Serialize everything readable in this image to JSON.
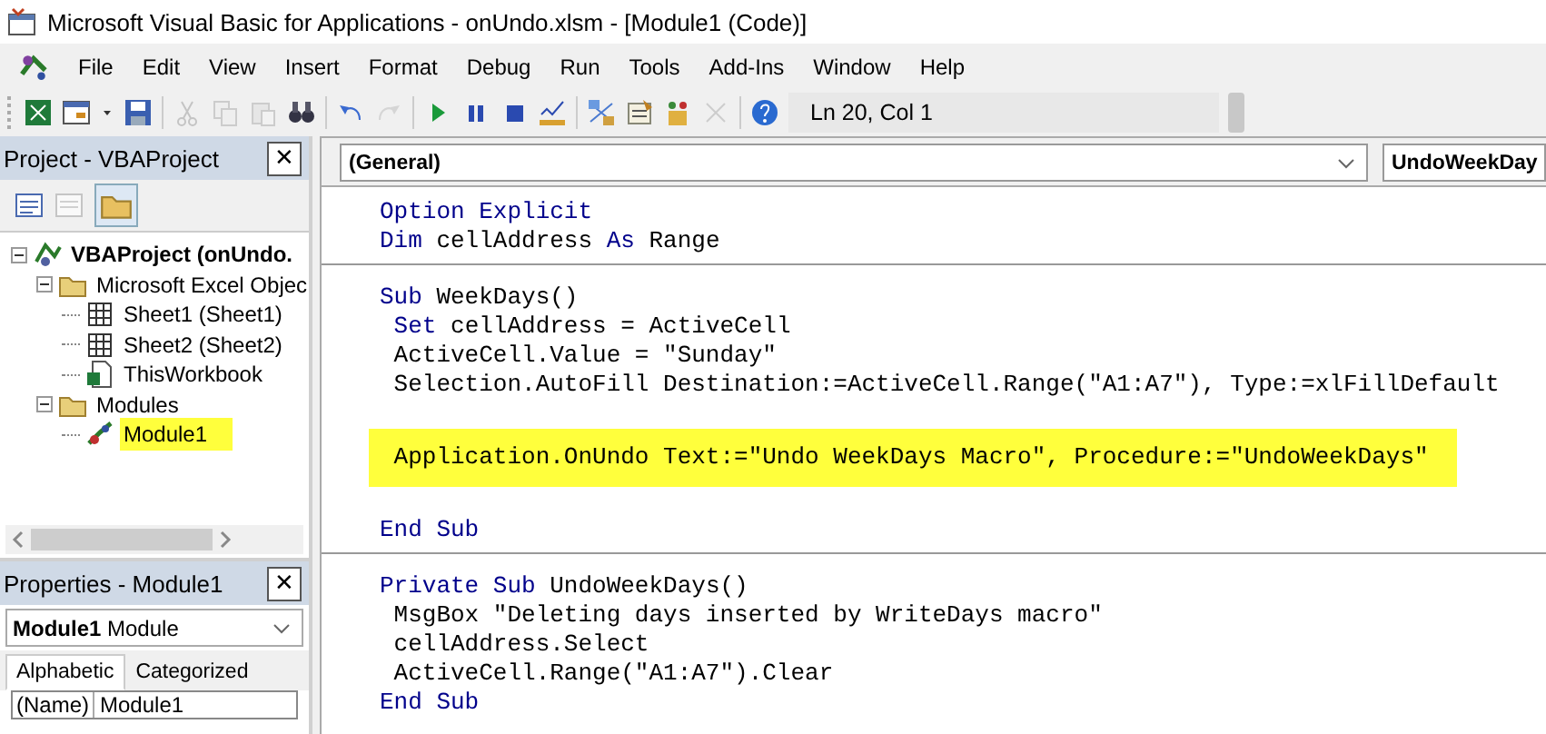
{
  "window": {
    "title": "Microsoft Visual Basic for Applications - onUndo.xlsm - [Module1 (Code)]"
  },
  "menu": [
    "File",
    "Edit",
    "View",
    "Insert",
    "Format",
    "Debug",
    "Run",
    "Tools",
    "Add-Ins",
    "Window",
    "Help"
  ],
  "toolbar": {
    "icons": [
      {
        "kind": "excel"
      },
      {
        "kind": "userform"
      },
      {
        "kind": "dropdown"
      },
      {
        "kind": "save"
      },
      {
        "kind": "sep"
      },
      {
        "kind": "cut",
        "disabled": true
      },
      {
        "kind": "copy",
        "disabled": true
      },
      {
        "kind": "paste",
        "disabled": true
      },
      {
        "kind": "find"
      },
      {
        "kind": "sep"
      },
      {
        "kind": "undo"
      },
      {
        "kind": "redo",
        "disabled": true
      },
      {
        "kind": "sep"
      },
      {
        "kind": "run"
      },
      {
        "kind": "pause"
      },
      {
        "kind": "stop"
      },
      {
        "kind": "design"
      },
      {
        "kind": "sep"
      },
      {
        "kind": "explorer"
      },
      {
        "kind": "properties"
      },
      {
        "kind": "browser"
      },
      {
        "kind": "tools",
        "disabled": true
      },
      {
        "kind": "sep"
      },
      {
        "kind": "help"
      }
    ],
    "position": "Ln 20, Col 1"
  },
  "project_panel": {
    "title": "Project - VBAProject",
    "close": "✕",
    "tree": [
      {
        "label": "VBAProject (onUndo.",
        "kind": "project",
        "bold": true,
        "expanded": true,
        "selected": false,
        "children": [
          {
            "label": "Microsoft Excel Objec",
            "kind": "folder",
            "expanded": true,
            "selected": false,
            "children": [
              {
                "label": "Sheet1 (Sheet1)",
                "kind": "sheet",
                "selected": false
              },
              {
                "label": "Sheet2 (Sheet2)",
                "kind": "sheet",
                "selected": false
              },
              {
                "label": "ThisWorkbook",
                "kind": "workbook",
                "selected": false
              }
            ]
          },
          {
            "label": "Modules",
            "kind": "folder",
            "expanded": true,
            "selected": false,
            "children": [
              {
                "label": "Module1",
                "kind": "module",
                "selected": true
              }
            ]
          }
        ]
      }
    ]
  },
  "properties_panel": {
    "title": "Properties - Module1",
    "close": "✕",
    "object_name": "Module1",
    "object_type": "Module",
    "tabs": [
      {
        "label": "Alphabetic",
        "selected": true
      },
      {
        "label": "Categorized",
        "selected": false
      }
    ],
    "rows": [
      {
        "name": "(Name)",
        "value": "Module1"
      }
    ]
  },
  "code_window": {
    "object_combo": "(General)",
    "procedure_combo": "UndoWeekDay",
    "procedures": [
      {
        "lines": [
          {
            "kind": "code",
            "tokens": [
              {
                "text": "Option Explicit",
                "keyword": true
              }
            ],
            "highlighted": false
          },
          {
            "kind": "code",
            "tokens": [
              {
                "text": "Dim",
                "keyword": true
              },
              {
                "text": " cellAddress ",
                "keyword": false
              },
              {
                "text": "As",
                "keyword": true
              },
              {
                "text": " Range",
                "keyword": false
              }
            ],
            "highlighted": false
          }
        ]
      },
      {
        "lines": [
          {
            "kind": "code",
            "tokens": [
              {
                "text": "Sub",
                "keyword": true
              },
              {
                "text": " WeekDays()",
                "keyword": false
              }
            ],
            "highlighted": false
          },
          {
            "kind": "code",
            "tokens": [
              {
                "text": " Set",
                "keyword": true
              },
              {
                "text": " cellAddress = ActiveCell",
                "keyword": false
              }
            ],
            "highlighted": false
          },
          {
            "kind": "code",
            "tokens": [
              {
                "text": " ActiveCell.Value = \"Sunday\"",
                "keyword": false
              }
            ],
            "highlighted": false
          },
          {
            "kind": "code",
            "tokens": [
              {
                "text": " Selection.AutoFill Destination:=ActiveCell.Range(\"A1:A7\"), Type:=xlFillDefault",
                "keyword": false
              }
            ],
            "highlighted": false
          },
          {
            "kind": "blank"
          },
          {
            "kind": "code",
            "tokens": [
              {
                "text": " Application.OnUndo Text:=\"Undo WeekDays Macro\", Procedure:=\"UndoWeekDays\"",
                "keyword": false
              }
            ],
            "highlighted": true
          },
          {
            "kind": "blank"
          },
          {
            "kind": "code",
            "tokens": [
              {
                "text": "End Sub",
                "keyword": true
              }
            ],
            "highlighted": false
          }
        ]
      },
      {
        "lines": [
          {
            "kind": "code",
            "tokens": [
              {
                "text": "Private Sub",
                "keyword": true
              },
              {
                "text": " UndoWeekDays()",
                "keyword": false
              }
            ],
            "highlighted": false
          },
          {
            "kind": "code",
            "tokens": [
              {
                "text": " MsgBox \"Deleting days inserted by WriteDays macro\"",
                "keyword": false
              }
            ],
            "highlighted": false
          },
          {
            "kind": "code",
            "tokens": [
              {
                "text": " cellAddress.Select",
                "keyword": false
              }
            ],
            "highlighted": false
          },
          {
            "kind": "code",
            "tokens": [
              {
                "text": " ActiveCell.Range(\"A1:A7\").Clear",
                "keyword": false
              }
            ],
            "highlighted": false
          },
          {
            "kind": "code",
            "tokens": [
              {
                "text": "End Sub",
                "keyword": true
              }
            ],
            "highlighted": false
          }
        ]
      }
    ]
  }
}
